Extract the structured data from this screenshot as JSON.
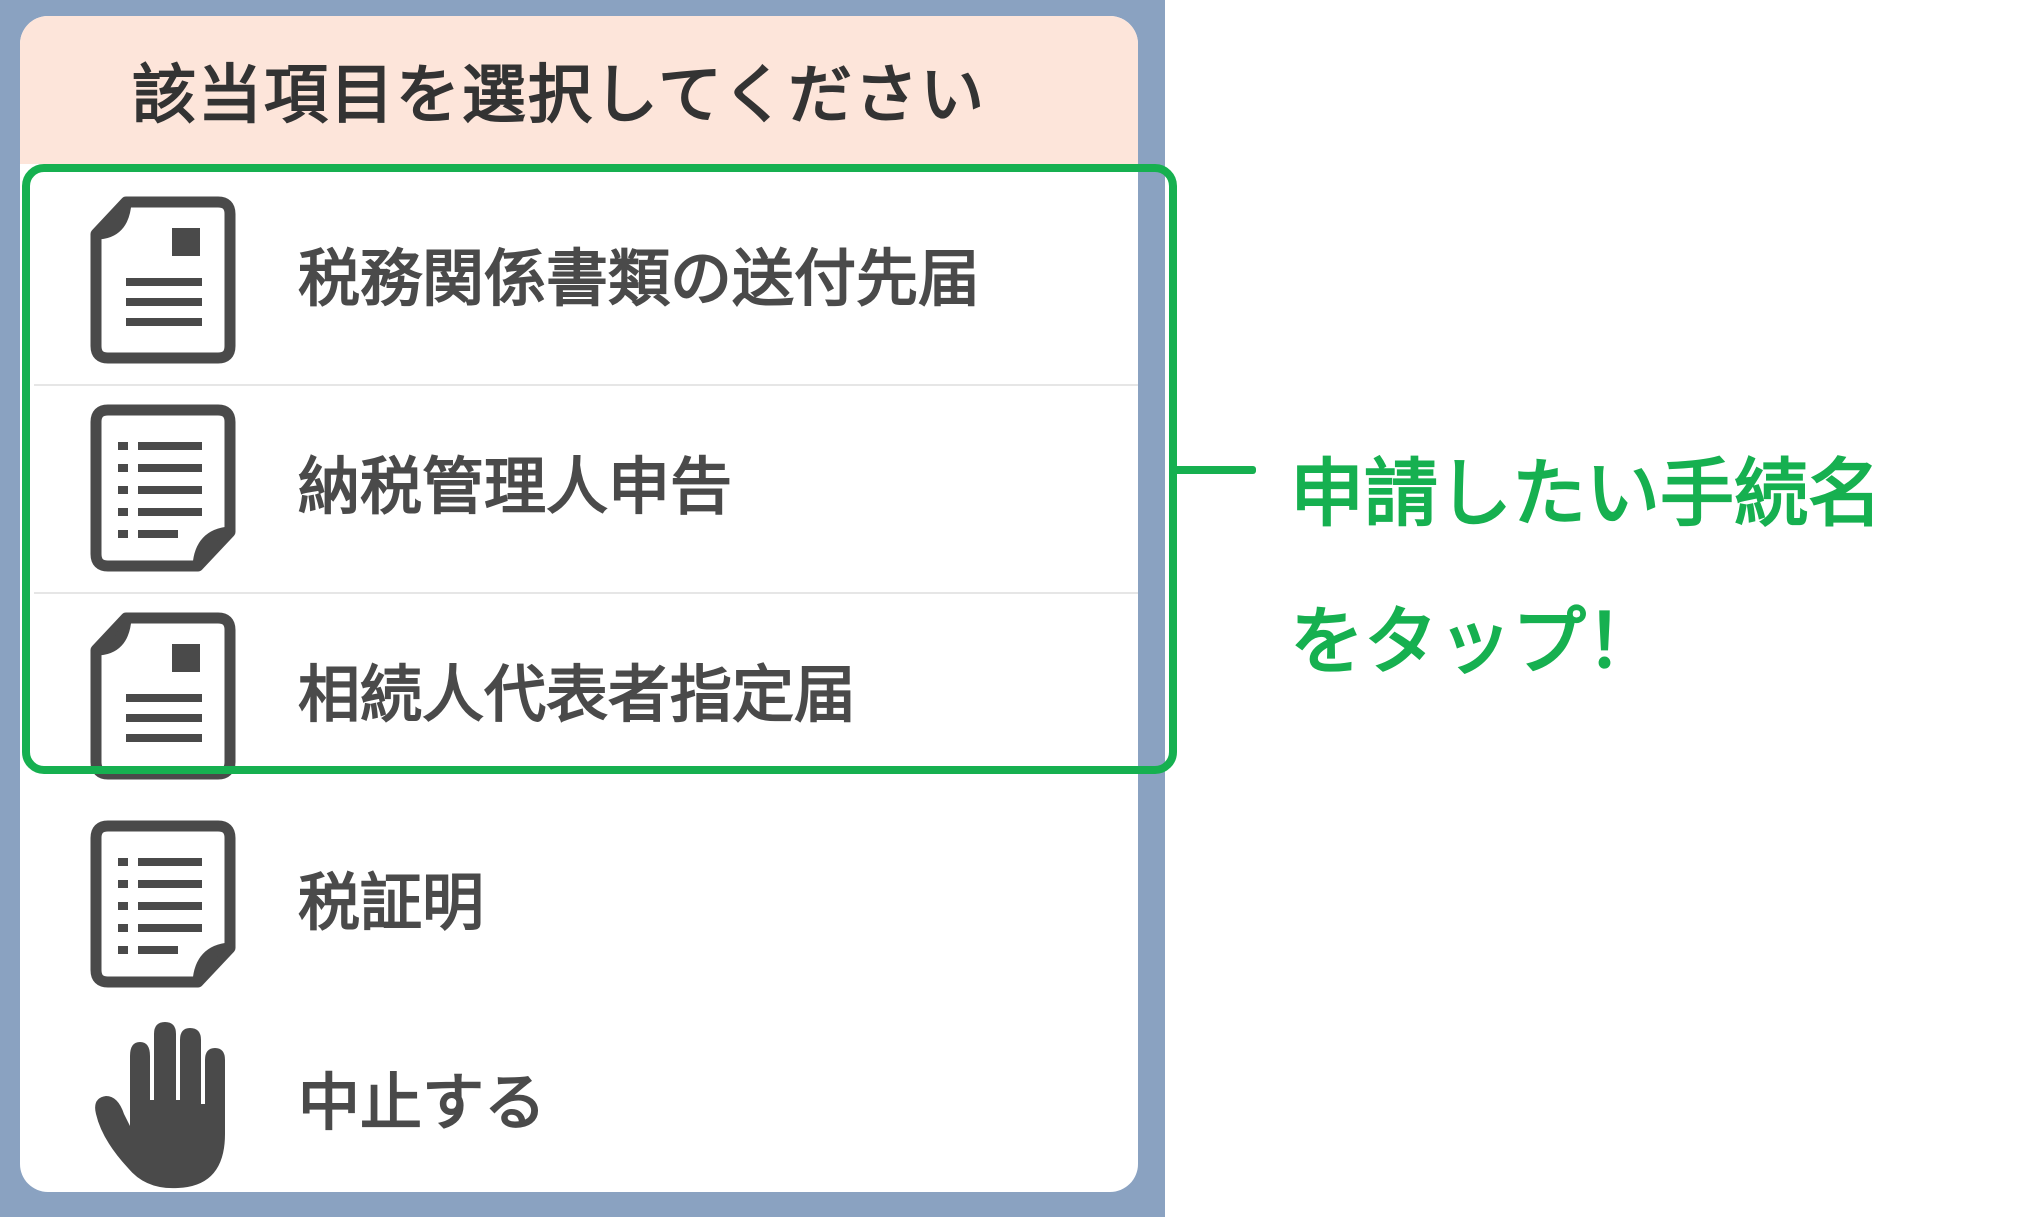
{
  "dialog": {
    "title": "該当項目を選択してください",
    "items": [
      {
        "label": "税務関係書類の送付先届",
        "icon": "document-icon"
      },
      {
        "label": "納税管理人申告",
        "icon": "list-document-icon"
      },
      {
        "label": "相続人代表者指定届",
        "icon": "document-icon"
      },
      {
        "label": "税証明",
        "icon": "list-document-icon"
      },
      {
        "label": "中止する",
        "icon": "hand-stop-icon"
      }
    ]
  },
  "annotation": {
    "line1": "申請したい手続名",
    "line2": "をタップ！",
    "color": "#16b050"
  },
  "colors": {
    "frame": "#8aa2c1",
    "header_bg": "#fde5da",
    "icon": "#4a4a4a",
    "highlight": "#16b050"
  }
}
